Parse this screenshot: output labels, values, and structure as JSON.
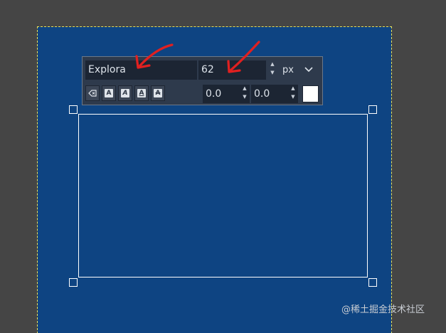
{
  "toolbar": {
    "font_name": "Explora",
    "font_size": "62",
    "unit": "px",
    "offset_x": "0.0",
    "offset_y": "0.0",
    "text_color": "#ffffff",
    "style_button_glyph": "A"
  },
  "canvas": {
    "background_color": "#0e4482"
  },
  "annotations": {
    "arrow_color": "#e02020"
  },
  "watermark": "@稀土掘金技术社区"
}
